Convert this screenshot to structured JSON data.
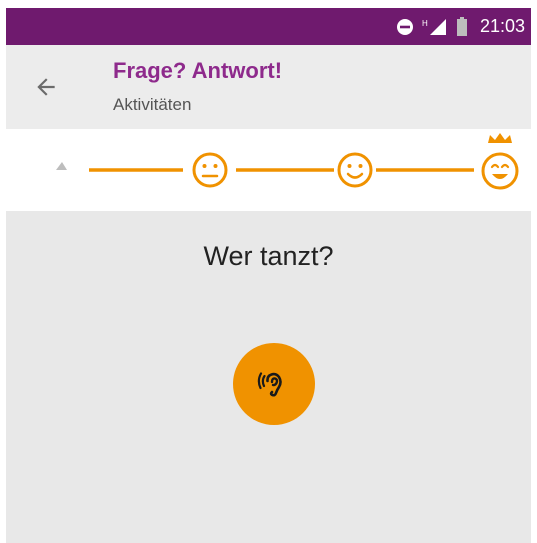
{
  "status_bar": {
    "time": "21:03",
    "icons": [
      "do-not-disturb-icon",
      "signal-icon",
      "battery-icon"
    ],
    "background": "#6f1a6e"
  },
  "header": {
    "title": "Frage? Antwort!",
    "subtitle": "Aktivitäten",
    "title_color": "#8e2a8c",
    "back_icon": "arrow-back-icon"
  },
  "progress": {
    "steps": [
      "start-marker-icon",
      "neutral-face-icon",
      "smile-face-icon",
      "crowned-happy-face-icon"
    ],
    "accent_color": "#f09200"
  },
  "main": {
    "question": "Wer tanzt?",
    "listen_button_icon": "ear-icon",
    "button_color": "#f09200"
  }
}
